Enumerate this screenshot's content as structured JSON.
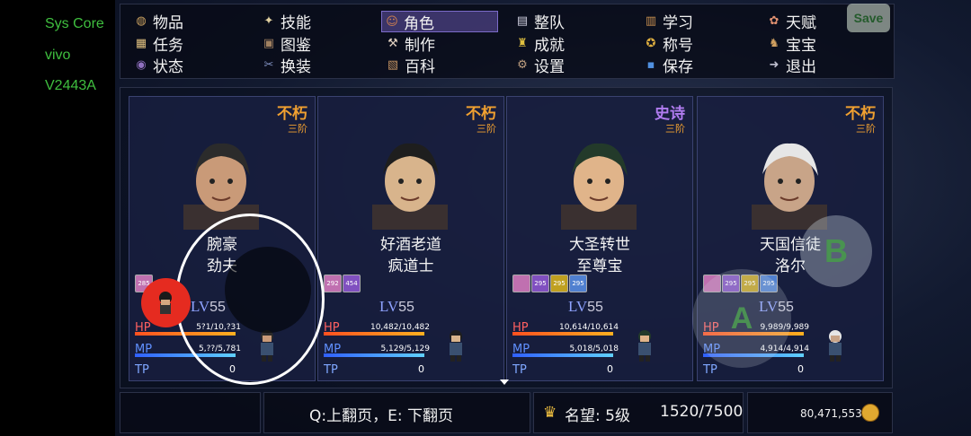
{
  "system": {
    "brand": "Sys Core",
    "vendor": "vivo",
    "model": "V2443A"
  },
  "menu": [
    {
      "label": "物品",
      "icon": "bag-icon"
    },
    {
      "label": "技能",
      "icon": "skill-icon"
    },
    {
      "label": "角色",
      "icon": "mask-icon",
      "selected": true
    },
    {
      "label": "整队",
      "icon": "formation-icon"
    },
    {
      "label": "学习",
      "icon": "book-icon"
    },
    {
      "label": "天赋",
      "icon": "talent-icon"
    },
    {
      "label": "任务",
      "icon": "scroll-icon"
    },
    {
      "label": "图鉴",
      "icon": "codex-icon"
    },
    {
      "label": "制作",
      "icon": "craft-icon"
    },
    {
      "label": "成就",
      "icon": "trophy-icon"
    },
    {
      "label": "称号",
      "icon": "medal-icon"
    },
    {
      "label": "宝宝",
      "icon": "pet-icon"
    },
    {
      "label": "状态",
      "icon": "status-icon"
    },
    {
      "label": "换装",
      "icon": "outfit-icon"
    },
    {
      "label": "百科",
      "icon": "encyclopedia-icon"
    },
    {
      "label": "设置",
      "icon": "gear-icon"
    },
    {
      "label": "保存",
      "icon": "floppy-icon"
    },
    {
      "label": "退出",
      "icon": "exit-icon"
    }
  ],
  "save_button": "Save",
  "characters": [
    {
      "rarity": "不朽",
      "rarity_color": "#f0a030",
      "tier": "三阶",
      "title": "腕豪",
      "name": "劲夫",
      "badges": [
        "285"
      ],
      "level_prefix": "LV",
      "level": "55",
      "hp_label": "HP",
      "hp": "5?1/10,?31",
      "mp_label": "MP",
      "mp": "5,??/5,781",
      "tp_label": "TP",
      "tp": "0",
      "portrait_color": "#c99a78",
      "hair": "#2b2b2b"
    },
    {
      "rarity": "不朽",
      "rarity_color": "#f0a030",
      "tier": "三阶",
      "title": "好酒老道",
      "name": "疯道士",
      "badges": [
        "292",
        "454"
      ],
      "level_prefix": "LV",
      "level": "55",
      "hp_label": "HP",
      "hp": "10,482/10,482",
      "mp_label": "MP",
      "mp": "5,129/5,129",
      "tp_label": "TP",
      "tp": "0",
      "portrait_color": "#d8b48c",
      "hair": "#1e1e1e"
    },
    {
      "rarity": "史诗",
      "rarity_color": "#b07cf0",
      "tier": "三阶",
      "title": "大圣转世",
      "name": "至尊宝",
      "badges": [
        "",
        "295",
        "295",
        "295"
      ],
      "level_prefix": "LV",
      "level": "55",
      "hp_label": "HP",
      "hp": "10,614/10,614",
      "mp_label": "MP",
      "mp": "5,018/5,018",
      "tp_label": "TP",
      "tp": "0",
      "portrait_color": "#e0b48a",
      "hair": "#233a2a"
    },
    {
      "rarity": "不朽",
      "rarity_color": "#f0a030",
      "tier": "三阶",
      "title": "天国信徒",
      "name": "洛尔",
      "badges": [
        "",
        "295",
        "295",
        "295"
      ],
      "level_prefix": "LV",
      "level": "55",
      "hp_label": "HP",
      "hp": "9,989/9,989",
      "mp_label": "MP",
      "mp": "4,914/4,914",
      "tp_label": "TP",
      "tp": "0",
      "portrait_color": "#c8a488",
      "hair": "#e6e6e6"
    }
  ],
  "bottom": {
    "hint": "Q:上翻页，E: 下翻页",
    "fame_label": "名望: 5级",
    "fame_progress": "1520/7500",
    "gold": "80,471,553"
  },
  "controls": {
    "b_label": "B",
    "a_label": "A"
  }
}
